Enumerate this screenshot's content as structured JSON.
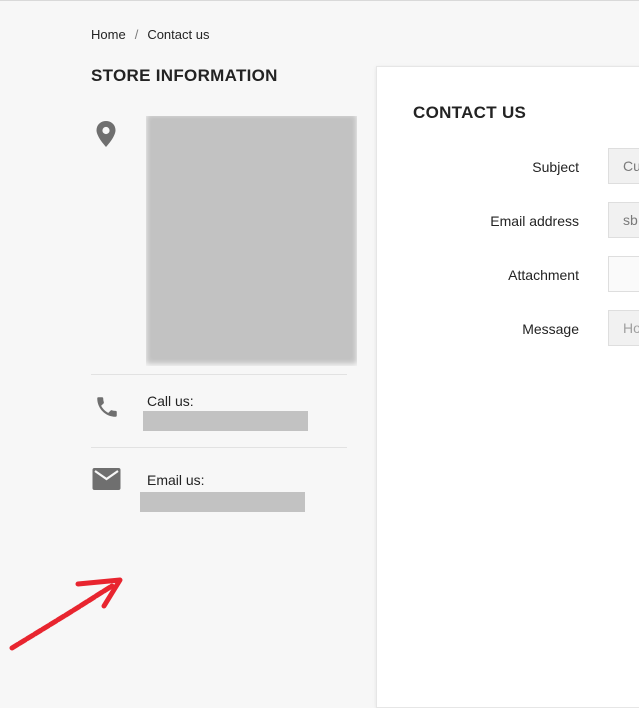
{
  "breadcrumb": {
    "home": "Home",
    "separator": "/",
    "current": "Contact us"
  },
  "store": {
    "title": "STORE INFORMATION",
    "call_label": "Call us:",
    "email_label": "Email us:"
  },
  "contact": {
    "title": "CONTACT US",
    "subject_label": "Subject",
    "subject_value": "Cu",
    "email_label": "Email address",
    "email_value": "sb",
    "attachment_label": "Attachment",
    "attachment_value": "",
    "message_label": "Message",
    "message_placeholder": "Ho"
  },
  "icons": {
    "location": "location-pin-icon",
    "phone": "phone-icon",
    "email": "envelope-icon",
    "annotation": "red-arrow-annotation"
  },
  "colors": {
    "icon": "#6f6f6f",
    "redaction": "#c2c2c2",
    "annotation": "#e8252f"
  }
}
